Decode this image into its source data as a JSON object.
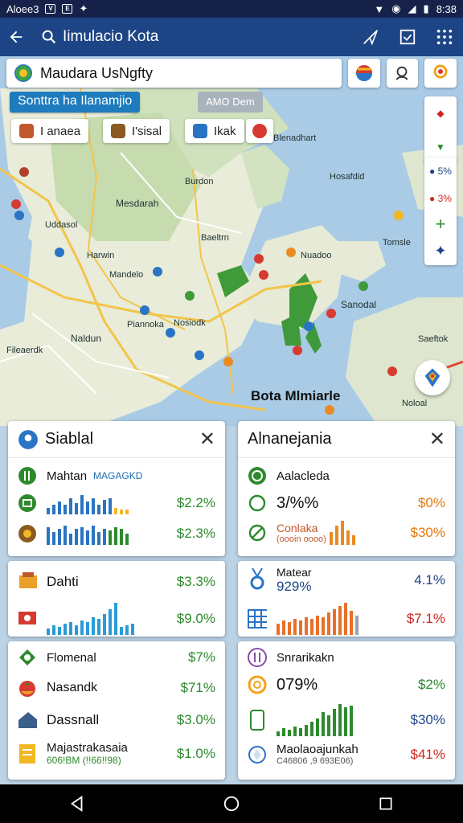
{
  "status_bar": {
    "carrier": "Aloee3",
    "time": "8:38"
  },
  "app_bar": {
    "title": "Iimulacio Kota"
  },
  "search": {
    "value": "Maudara UsNgfty"
  },
  "map": {
    "banner": "Sonttra ha Ilanamjio",
    "banner_secondary": "AMO Dem",
    "chips": [
      "I anaea",
      "I'sisal",
      "Ikak"
    ],
    "labels": [
      "Blenadhart",
      "Mesdarah",
      "Burdon",
      "Baeltrn",
      "Mandelo",
      "Harwin",
      "Hosafdid",
      "Saeftok",
      "Sanodal",
      "Nuadoo",
      "Naldun",
      "Piannoka",
      "Nosiodk",
      "Fileaerdk",
      "Tomsle",
      "Noloal",
      "Uddasol"
    ],
    "title": "Bota Mlmiarle"
  },
  "left_card": {
    "title": "Siablal",
    "rows": [
      {
        "label": "Mahtan",
        "sub": "MAGAGKD",
        "value": ""
      },
      {
        "label": "",
        "value": "$2.2%"
      },
      {
        "label": "",
        "value": "$2.3%"
      }
    ],
    "card2": [
      {
        "label": "Dahti",
        "value": "$3.3%"
      },
      {
        "label": "",
        "value": "$9.0%"
      }
    ],
    "card3": [
      {
        "label": "Flomenal",
        "value": "$7%"
      },
      {
        "label": "Nasandk",
        "value": "$71%"
      },
      {
        "label": "Dassnall",
        "value": "$3.0%"
      },
      {
        "label": "Majastrakasaia",
        "sub": "606!BM (!!66!!98)",
        "value": "$1.0%"
      }
    ]
  },
  "right_card": {
    "title": "Alnanejania",
    "rows": [
      {
        "label": "Aalacleda",
        "value": ""
      },
      {
        "label": "3/%%",
        "value": "$0%"
      },
      {
        "label": "Conlaka",
        "sub": "(oooin oooo)",
        "value": "$30%"
      }
    ],
    "card2": [
      {
        "label": "Matear",
        "sub": "929%",
        "value": "4.1%"
      },
      {
        "label": "",
        "value": "$7.1%"
      }
    ],
    "card3": [
      {
        "label": "Snrarikakn",
        "value": ""
      },
      {
        "label": "079%",
        "value": "$2%"
      },
      {
        "label": "",
        "value": "$30%"
      },
      {
        "label": "Maolaoajunkah",
        "sub": "C46806 ,9 693E06)",
        "value": "$41%"
      }
    ]
  },
  "colors": {
    "primary": "#1d4586",
    "accent": "#1e7bbd",
    "positive": "#2d8a2d",
    "warning": "#e07a10",
    "negative": "#d0261f"
  }
}
